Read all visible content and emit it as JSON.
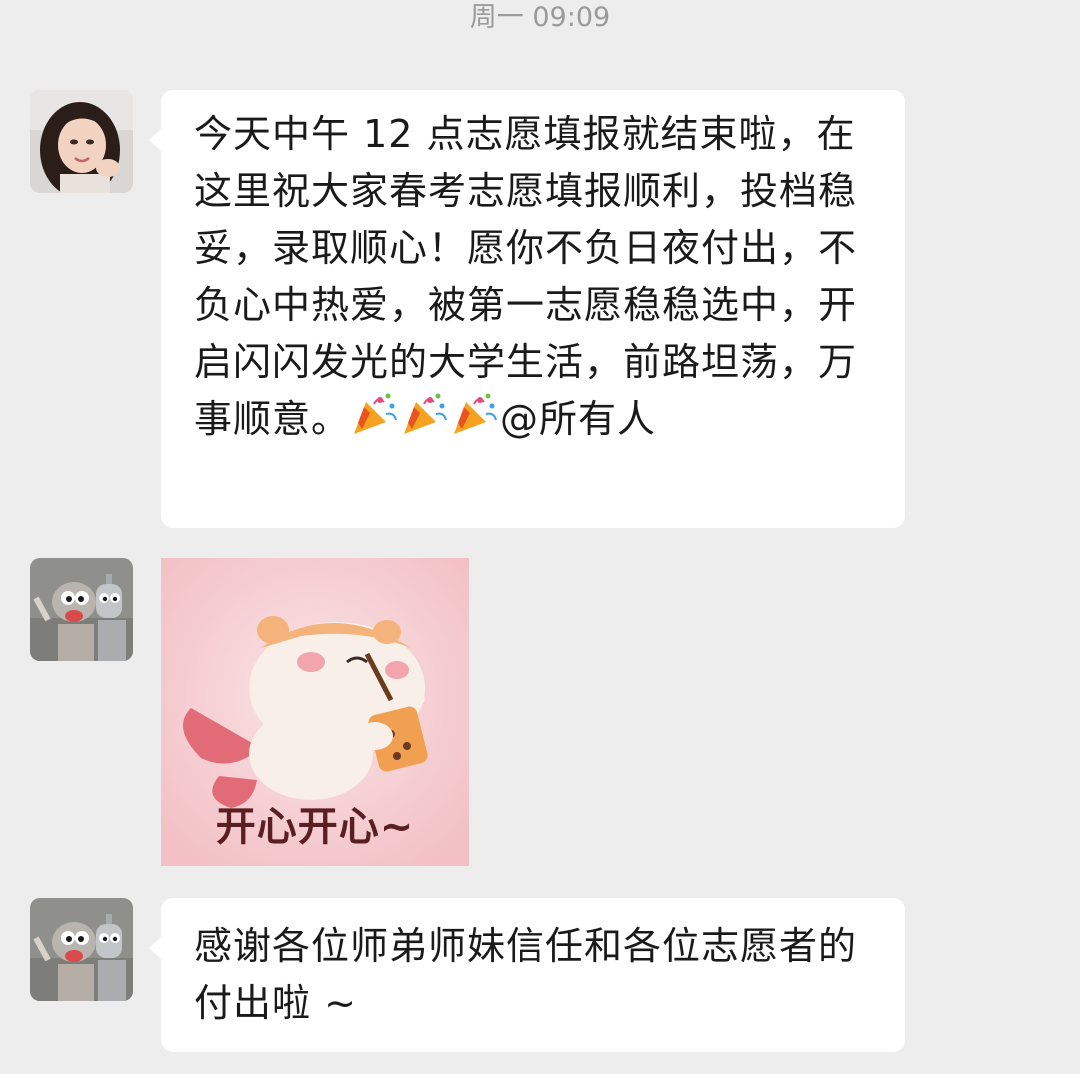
{
  "header": {
    "timestamp": "周一 09:09"
  },
  "messages": [
    {
      "type": "text",
      "sender_avatar": "avatar-girl",
      "text_main": "今天中午 12 点志愿填报就结束啦，在这里祝大家春考志愿填报顺利，投档稳妥，录取顺心！愿你不负日夜付出，不负心中热爱，被第一志愿稳稳选中，开启闪闪发光的大学生活，前路坦荡，万事顺意。",
      "emojis": [
        "party-popper-icon",
        "party-popper-icon",
        "party-popper-icon"
      ],
      "mention": "@所有人"
    },
    {
      "type": "sticker",
      "sender_avatar": "avatar-cartoon-robots",
      "sticker_caption": "开心开心~"
    },
    {
      "type": "text",
      "sender_avatar": "avatar-cartoon-robots",
      "text_main": "感谢各位师弟师妹信任和各位志愿者的付出啦 ~"
    }
  ],
  "colors": {
    "background": "#ededed",
    "bubble": "#ffffff",
    "timestamp": "#9a9a9a",
    "text": "#1a1a1a"
  }
}
